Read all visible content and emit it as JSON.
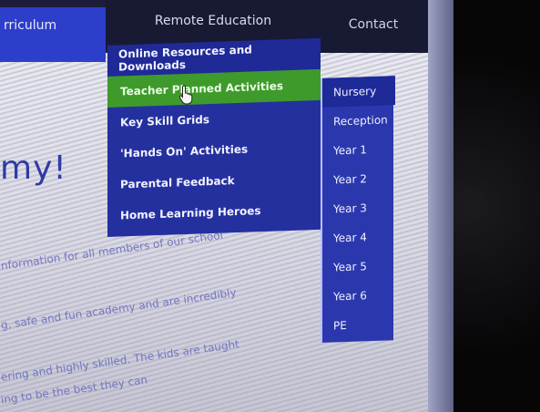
{
  "nav": {
    "items": [
      {
        "label": "rriculum"
      },
      {
        "label": "Remote Education"
      },
      {
        "label": "Contact"
      }
    ]
  },
  "dropdown": {
    "items": [
      {
        "label": "Online Resources and Downloads"
      },
      {
        "label": "Teacher Planned Activities"
      },
      {
        "label": "Key Skill Grids"
      },
      {
        "label": "'Hands On' Activities"
      },
      {
        "label": "Parental Feedback"
      },
      {
        "label": "Home Learning Heroes"
      }
    ]
  },
  "submenu": {
    "items": [
      {
        "label": "Nursery"
      },
      {
        "label": "Reception"
      },
      {
        "label": "Year 1"
      },
      {
        "label": "Year 2"
      },
      {
        "label": "Year 3"
      },
      {
        "label": "Year 4"
      },
      {
        "label": "Year 5"
      },
      {
        "label": "Year 6"
      },
      {
        "label": "PE"
      }
    ]
  },
  "page": {
    "headline": "my!",
    "body_lines": [
      "nformation for all members of our school",
      "g, safe and fun academy and are incredibly",
      "ering and highly skilled. The kids are taught",
      "ing to be the best they can"
    ]
  },
  "colors": {
    "nav_active": "#2d3ecb",
    "dropdown": "#25309f",
    "highlight": "#3f9a2c",
    "submenu": "#2b38ad"
  }
}
